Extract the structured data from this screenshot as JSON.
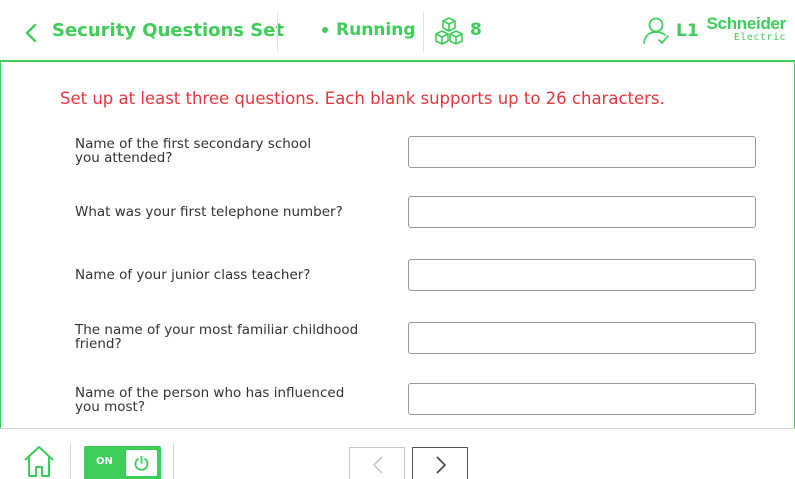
{
  "header": {
    "title": "Security Questions Set",
    "status": "Running",
    "modules_count": "8",
    "user_level": "L1",
    "logo_top": "Schneider",
    "logo_bottom": "Electric"
  },
  "instruction": "Set up at least three questions. Each blank supports up to 26 characters.",
  "questions": [
    {
      "label_line1": "Name of the first secondary school",
      "label_line2": "you attended?",
      "value": ""
    },
    {
      "label_line1": "What was your first telephone number?",
      "label_line2": "",
      "value": ""
    },
    {
      "label_line1": "Name of your junior class teacher?",
      "label_line2": "",
      "value": ""
    },
    {
      "label_line1": "The name of your most familiar childhood",
      "label_line2": "friend?",
      "value": ""
    },
    {
      "label_line1": "Name of the person who has influenced",
      "label_line2": "you most?",
      "value": ""
    }
  ],
  "footer": {
    "toggle_label": "ON"
  },
  "colors": {
    "accent": "#3dcd58",
    "warning_text": "#e8363c"
  },
  "icons": [
    "back-chevron-icon",
    "modules-icon",
    "user-icon",
    "home-icon",
    "power-icon",
    "chevron-left-icon",
    "chevron-right-icon"
  ]
}
